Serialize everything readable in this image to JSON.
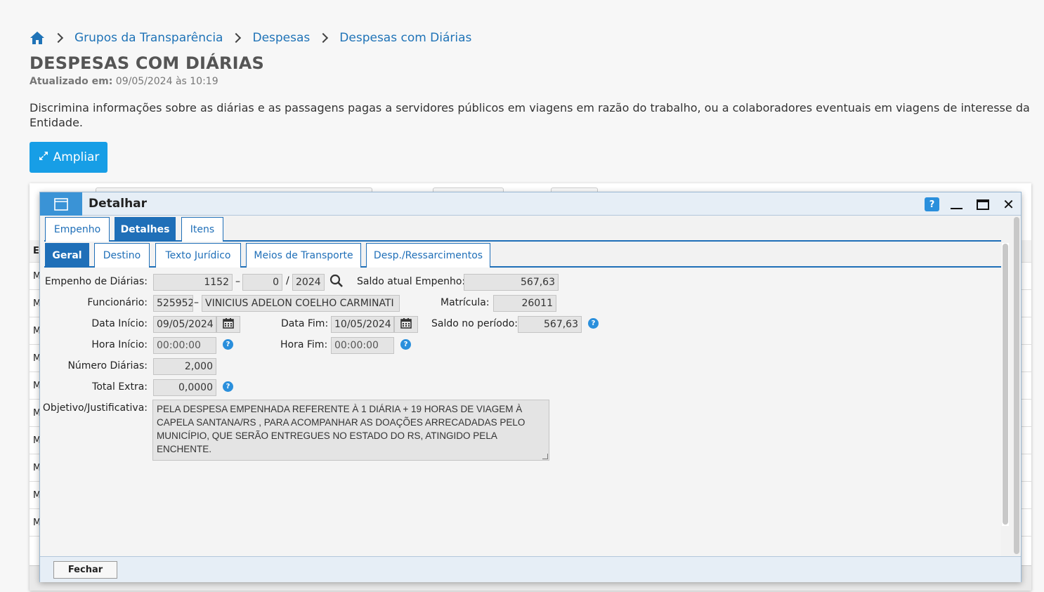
{
  "breadcrumb": {
    "home_icon": "home-icon",
    "items": [
      "Grupos da Transparência",
      "Despesas",
      "Despesas com Diárias"
    ]
  },
  "page": {
    "title": "DESPESAS COM DIÁRIAS",
    "updated_label": "Atualizado em:",
    "updated_value": "09/05/2024 às 10:19",
    "description": "Discrimina informações sobre as diárias e as passagens pagas a servidores públicos em viagens em razão do trabalho, ou a colaboradores eventuais em viagens de interesse da Entidade.",
    "ampliar_label": "Ampliar"
  },
  "background_grid": {
    "header_letter": "E",
    "row_letter": "M"
  },
  "dialog": {
    "title": "Detalhar",
    "help_label": "?",
    "tabs_top": [
      "Empenho",
      "Detalhes",
      "Itens"
    ],
    "tabs_top_active": "Detalhes",
    "tabs_sub": [
      "Geral",
      "Destino",
      "Texto Jurídico",
      "Meios de Transporte",
      "Desp./Ressarcimentos"
    ],
    "tabs_sub_active": "Geral",
    "fields": {
      "empenho_label": "Empenho de Diárias:",
      "empenho_num": "1152",
      "empenho_sub": "0",
      "empenho_ano": "2024",
      "saldo_atual_label": "Saldo atual Empenho:",
      "saldo_atual": "567,63",
      "funcionario_label": "Funcionário:",
      "funcionario_code": "525952",
      "funcionario_name": "VINICIUS ADELON COELHO CARMINATI",
      "matricula_label": "Matrícula:",
      "matricula": "26011",
      "data_inicio_label": "Data Início:",
      "data_inicio": "09/05/2024",
      "data_fim_label": "Data Fim:",
      "data_fim": "10/05/2024",
      "saldo_periodo_label": "Saldo no período:",
      "saldo_periodo": "567,63",
      "hora_inicio_label": "Hora Início:",
      "hora_inicio": "00:00:00",
      "hora_fim_label": "Hora Fim:",
      "hora_fim": "00:00:00",
      "numero_diarias_label": "Número Diárias:",
      "numero_diarias": "2,000",
      "total_extra_label": "Total Extra:",
      "total_extra": "0,0000",
      "objetivo_label": "Objetivo/Justificativa:",
      "objetivo": "PELA DESPESA EMPENHADA REFERENTE À 1 DIÁRIA + 19 HORAS DE  VIAGEM À CAPELA SANTANA/RS ,  PARA  ACOMPANHAR AS DOAÇÕES ARRECADADAS PELO MUNICÍPIO, QUE SERÃO ENTREGUES NO ESTADO DO RS, ATINGIDO PELA ENCHENTE."
    },
    "fechar_label": "Fechar"
  },
  "colors": {
    "link": "#1f73b7",
    "accent": "#179ee6",
    "tab_active": "#1f6fb8",
    "help": "#2a8fdc"
  }
}
